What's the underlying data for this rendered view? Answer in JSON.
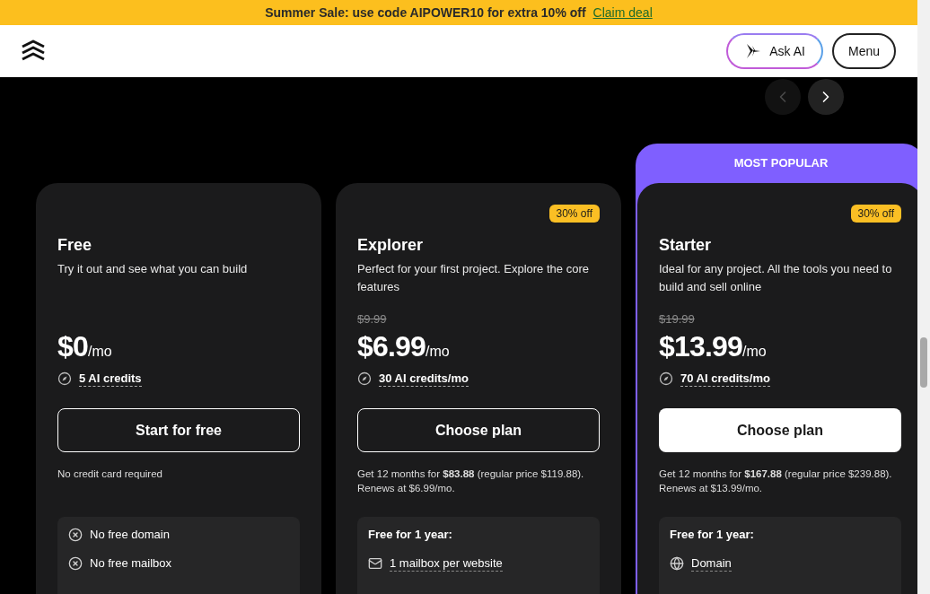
{
  "banner": {
    "text": "Summer Sale: use code AIPOWER10 for extra 10% off",
    "link": "Claim deal"
  },
  "header": {
    "ask_ai": "Ask AI",
    "menu": "Menu"
  },
  "carousel": [
    {
      "kind": "prev",
      "disabled": true
    },
    {
      "kind": "next",
      "disabled": false
    }
  ],
  "plans": [
    {
      "name": "Free",
      "description": "Try it out and see what you can build",
      "price": "$0",
      "per": "/mo",
      "credits": "5 AI credits",
      "button": {
        "label": "Start for free",
        "filled": false
      },
      "note": "No credit card required",
      "features": [
        {
          "kind": "excluded",
          "text": "No free domain"
        },
        {
          "kind": "excluded",
          "text": "No free mailbox"
        }
      ]
    },
    {
      "name": "Explorer",
      "badge": "30% off",
      "description": "Perfect for your first project. Explore the core features",
      "original_price": "$9.99",
      "price": "$6.99",
      "per": "/mo",
      "credits": "30 AI credits/mo",
      "button": {
        "label": "Choose plan",
        "filled": false
      },
      "note": "Get 12 months for **$83.88** (regular price $119.88). Renews at $6.99/mo.",
      "features_title": "Free for 1 year:",
      "features": [
        {
          "kind": "mailbox",
          "text": "1 mailbox per website"
        }
      ]
    },
    {
      "name": "Starter",
      "ribbon": "MOST POPULAR",
      "badge": "30% off",
      "description": "Ideal for any project. All the tools you need to build and sell online",
      "original_price": "$19.99",
      "price": "$13.99",
      "per": "/mo",
      "credits": "70 AI credits/mo",
      "button": {
        "label": "Choose plan",
        "filled": true
      },
      "note": "Get 12 months for **$167.88** (regular price $239.88). Renews at $13.99/mo.",
      "features_title": "Free for 1 year:",
      "features": [
        {
          "kind": "domain",
          "text": "Domain"
        }
      ]
    }
  ]
}
